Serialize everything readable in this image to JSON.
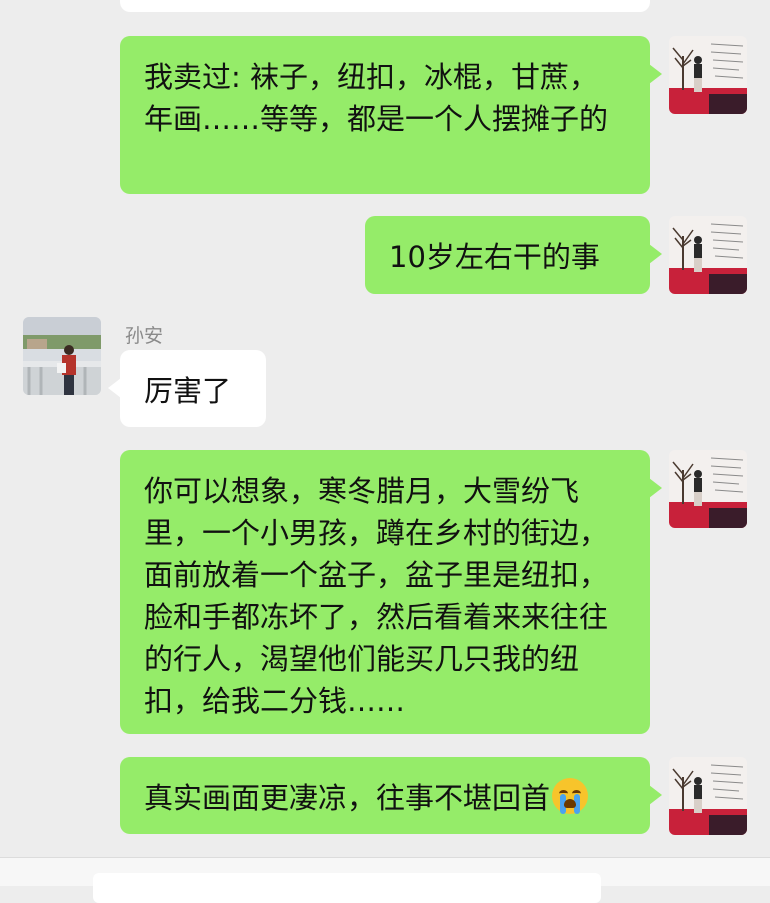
{
  "chat": {
    "messages": [
      {
        "side": "me",
        "text": "我卖过: 袜子，纽扣，冰棍，甘蔗，年画……等等，都是一个人摆摊子的"
      },
      {
        "side": "me",
        "text": "10岁左右干的事"
      },
      {
        "side": "them",
        "sender": "孙安",
        "text": "厉害了"
      },
      {
        "side": "me",
        "text": "你可以想象，寒冬腊月，大雪纷飞里，一个小男孩，蹲在乡村的街边，面前放着一个盆子，盆子里是纽扣，脸和手都冻坏了，然后看着来来往往的行人，渴望他们能买几只我的纽扣，给我二分钱……"
      },
      {
        "side": "me",
        "text": "真实画面更凄凉，往事不堪回首",
        "emoji": "loudly-crying-face"
      }
    ]
  },
  "colors": {
    "background": "#ededed",
    "my_bubble": "#95ec69",
    "their_bubble": "#ffffff",
    "sender_name": "#8a8a8a"
  }
}
